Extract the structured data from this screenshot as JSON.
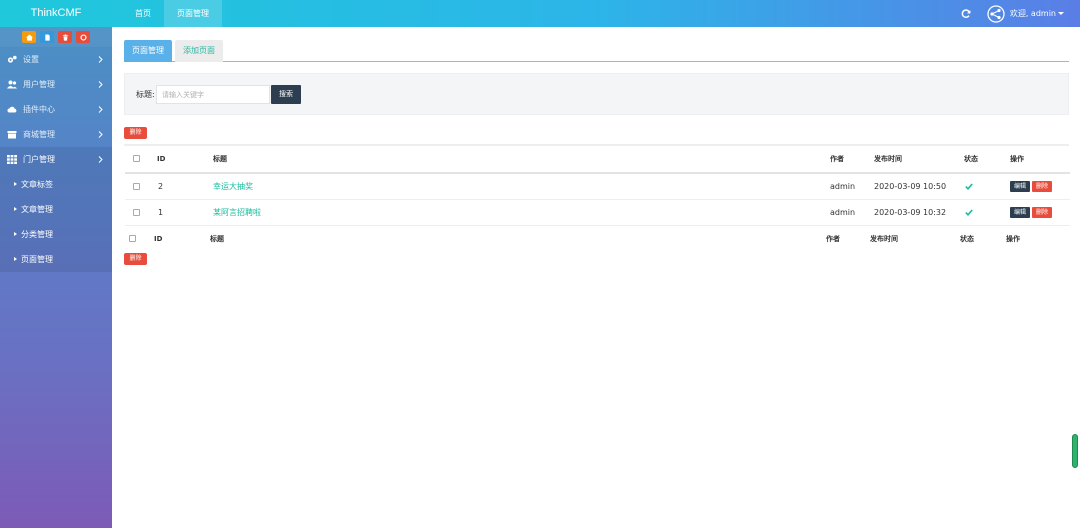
{
  "app": {
    "brand": "ThinkCMF"
  },
  "topnav": {
    "items": [
      "首页",
      "页面管理"
    ],
    "active_index": 1
  },
  "user": {
    "welcome": "欢迎, admin"
  },
  "sidebar": {
    "shortcut_colors": [
      "#f39c12",
      "#3498db",
      "#e74c3c",
      "#e74c3c"
    ],
    "items": [
      {
        "label": "设置",
        "icon": "gears-icon"
      },
      {
        "label": "用户管理",
        "icon": "users-icon"
      },
      {
        "label": "插件中心",
        "icon": "cloud-icon"
      },
      {
        "label": "商城管理",
        "icon": "shop-icon"
      },
      {
        "label": "门户管理",
        "icon": "grid-icon"
      }
    ],
    "subitems": [
      "文章标签",
      "文章管理",
      "分类管理",
      "页面管理"
    ]
  },
  "tabs": {
    "active": "页面管理",
    "other": "添加页面"
  },
  "filter": {
    "label": "标题:",
    "placeholder": "请输入关键字",
    "search_label": "搜索"
  },
  "delete_label": "删除",
  "table": {
    "headers": {
      "id": "ID",
      "title": "标题",
      "author": "作者",
      "date": "发布时间",
      "status": "状态",
      "ops": "操作"
    },
    "rows": [
      {
        "id": "2",
        "title": "幸运大抽奖",
        "author": "admin",
        "date": "2020-03-09 10:50",
        "status": "published"
      },
      {
        "id": "1",
        "title": "某阿言招聘啦",
        "author": "admin",
        "date": "2020-03-09 10:32",
        "status": "published"
      }
    ],
    "edit_label": "编辑",
    "row_delete_label": "删除"
  },
  "colors": {
    "accent_green": "#18bc9c",
    "danger": "#e74c3c",
    "dark": "#2c3e50",
    "tab_active": "#5ab0e8"
  }
}
